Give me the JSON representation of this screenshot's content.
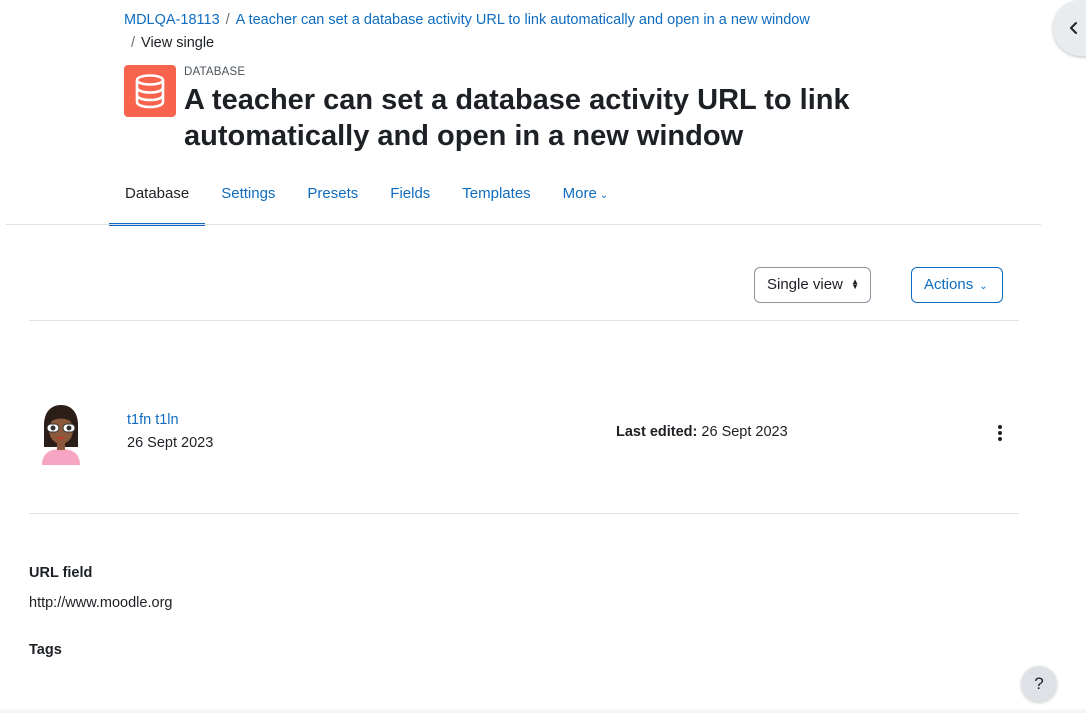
{
  "breadcrumb": {
    "course": "MDLQA-18113",
    "activity": "A teacher can set a database activity URL to link automatically and open in a new window",
    "current": "View single",
    "separator": "/"
  },
  "header": {
    "module_type": "DATABASE",
    "title": "A teacher can set a database activity URL to link automatically and open in a new window",
    "icon": "database-icon",
    "icon_color": "#f7634d"
  },
  "tabs": [
    {
      "label": "Database",
      "active": true
    },
    {
      "label": "Settings"
    },
    {
      "label": "Presets"
    },
    {
      "label": "Fields"
    },
    {
      "label": "Templates"
    },
    {
      "label": "More"
    }
  ],
  "controls": {
    "view_select": "Single view",
    "actions_label": "Actions"
  },
  "entry": {
    "author": "t1fn t1ln",
    "date": "26 Sept 2023",
    "last_edited_label": "Last edited:",
    "last_edited_value": "26 Sept 2023"
  },
  "fields": {
    "url_label": "URL field",
    "url_value": "http://www.moodle.org",
    "tags_label": "Tags"
  },
  "help": {
    "label": "?"
  },
  "colors": {
    "link": "#0f6cbf",
    "text": "#1d2125",
    "border": "#dee2e6"
  }
}
